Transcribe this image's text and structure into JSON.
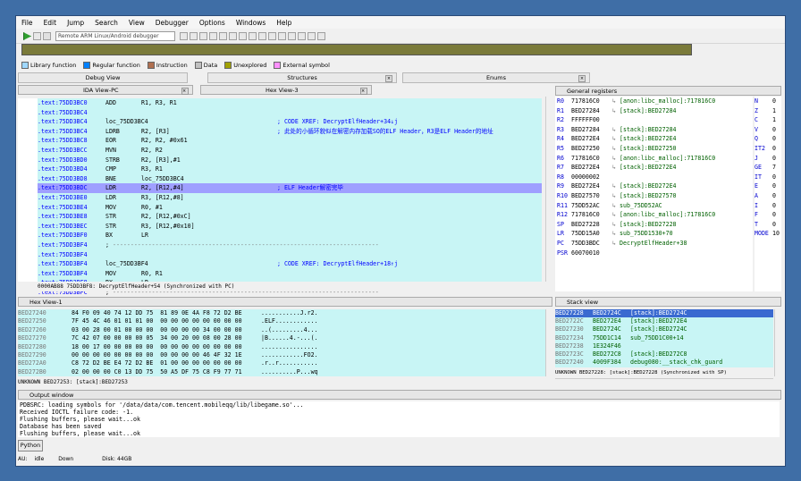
{
  "menu": [
    "File",
    "Edit",
    "Jump",
    "Search",
    "View",
    "Debugger",
    "Options",
    "Windows",
    "Help"
  ],
  "toolbar": {
    "debugger_select": "Remote ARM Linux/Android debugger"
  },
  "legend": [
    {
      "label": "Library function",
      "color": "#a0d8ff"
    },
    {
      "label": "Regular function",
      "color": "#0080ff"
    },
    {
      "label": "Instruction",
      "color": "#b07050"
    },
    {
      "label": "Data",
      "color": "#c0c0c0"
    },
    {
      "label": "Unexplored",
      "color": "#a0a000"
    },
    {
      "label": "External symbol",
      "color": "#ff90ff"
    }
  ],
  "top_tabs": [
    "Debug View",
    "Structures",
    "Enums"
  ],
  "ida_view": {
    "title": "IDA View-PC",
    "hex_tab": "Hex View-3"
  },
  "code_lines": [
    {
      "addr": ".text:75DD3BC0",
      "mn": "ADD",
      "op": "R1, R3, R1",
      "cm": "",
      "hl": false
    },
    {
      "addr": ".text:75DD3BC4",
      "mn": "",
      "op": "",
      "cm": "",
      "hl": false
    },
    {
      "addr": ".text:75DD3BC4",
      "mn": "loc_75DD3BC4",
      "op": "",
      "cm": "; CODE XREF: DecryptElfHeader+34↓j",
      "hl": false
    },
    {
      "addr": ".text:75DD3BC4",
      "mn": "LDRB",
      "op": "R2, [R3]",
      "cm": "; 此处的小循环貌似在解密内存加载SO的ELF Header，R3是ELF Header的地址",
      "hl": false
    },
    {
      "addr": ".text:75DD3BC8",
      "mn": "EOR",
      "op": "R2, R2, #0x61",
      "cm": "",
      "hl": false
    },
    {
      "addr": ".text:75DD3BCC",
      "mn": "MVN",
      "op": "R2, R2",
      "cm": "",
      "hl": false
    },
    {
      "addr": ".text:75DD3BD0",
      "mn": "STRB",
      "op": "R2, [R3],#1",
      "cm": "",
      "hl": false
    },
    {
      "addr": ".text:75DD3BD4",
      "mn": "CMP",
      "op": "R3, R1",
      "cm": "",
      "hl": false
    },
    {
      "addr": ".text:75DD3BD8",
      "mn": "BNE",
      "op": "loc_75DD3BC4",
      "cm": "",
      "hl": false
    },
    {
      "addr": ".text:75DD3BDC",
      "mn": "LDR",
      "op": "R2, [R12,#4]",
      "cm": "; ELF Header解密完毕",
      "hl": true
    },
    {
      "addr": ".text:75DD3BE0",
      "mn": "LDR",
      "op": "R3, [R12,#8]",
      "cm": "",
      "hl": false
    },
    {
      "addr": ".text:75DD3BE4",
      "mn": "MOV",
      "op": "R0, #1",
      "cm": "",
      "hl": false
    },
    {
      "addr": ".text:75DD3BE8",
      "mn": "STR",
      "op": "R2, [R12,#0xC]",
      "cm": "",
      "hl": false
    },
    {
      "addr": ".text:75DD3BEC",
      "mn": "STR",
      "op": "R3, [R12,#0x10]",
      "cm": "",
      "hl": false
    },
    {
      "addr": ".text:75DD3BF0",
      "mn": "BX",
      "op": "LR",
      "cm": "",
      "hl": false
    },
    {
      "addr": ".text:75DD3BF4",
      "mn": ";",
      "op": "---------------------------------------------------------------------------",
      "cm": "",
      "hl": false
    },
    {
      "addr": ".text:75DD3BF4",
      "mn": "",
      "op": "",
      "cm": "",
      "hl": false
    },
    {
      "addr": ".text:75DD3BF4",
      "mn": "loc_75DD3BF4",
      "op": "",
      "cm": "; CODE XREF: DecryptElfHeader+18↑j",
      "hl": false
    },
    {
      "addr": ".text:75DD3BF4",
      "mn": "MOV",
      "op": "R0, R1",
      "cm": "",
      "hl": false
    },
    {
      "addr": ".text:75DD3BF8",
      "mn": "BX",
      "op": "LR",
      "cm": "",
      "hl": false
    },
    {
      "addr": ".text:75DD3BFC",
      "mn": ";",
      "op": "---------------------------------------------------------------------------",
      "cm": "",
      "hl": false
    }
  ],
  "ida_status": "0000AB88 75DD3BF8: DecryptElfHeader+54 (Synchronized with PC)",
  "registers_title": "General registers",
  "registers": [
    {
      "n": "R0",
      "v": "717816C0",
      "d": "[anon:libc_malloc]:717816C0"
    },
    {
      "n": "R1",
      "v": "BED27284",
      "d": "[stack]:BED27284"
    },
    {
      "n": "R2",
      "v": "FFFFFF00",
      "d": ""
    },
    {
      "n": "R3",
      "v": "BED27284",
      "d": "[stack]:BED27284"
    },
    {
      "n": "R4",
      "v": "BED272E4",
      "d": "[stack]:BED272E4"
    },
    {
      "n": "R5",
      "v": "BED27250",
      "d": "[stack]:BED27250"
    },
    {
      "n": "R6",
      "v": "717816C0",
      "d": "[anon:libc_malloc]:717816C0"
    },
    {
      "n": "R7",
      "v": "BED272E4",
      "d": "[stack]:BED272E4"
    },
    {
      "n": "R8",
      "v": "00000002",
      "d": ""
    },
    {
      "n": "R9",
      "v": "BED272E4",
      "d": "[stack]:BED272E4"
    },
    {
      "n": "R10",
      "v": "BED27570",
      "d": "[stack]:BED27570"
    },
    {
      "n": "R11",
      "v": "75DD52AC",
      "d": "sub_75DD52AC"
    },
    {
      "n": "R12",
      "v": "717816C0",
      "d": "[anon:libc_malloc]:717816C0"
    },
    {
      "n": "SP",
      "v": "BED27228",
      "d": "[stack]:BED27228"
    },
    {
      "n": "LR",
      "v": "75DD15A0",
      "d": "sub_75DD1530+70"
    },
    {
      "n": "PC",
      "v": "75DD3BDC",
      "d": "DecryptElfHeader+38"
    },
    {
      "n": "PSR",
      "v": "60070010",
      "d": ""
    }
  ],
  "flags": [
    {
      "n": "N",
      "v": "0"
    },
    {
      "n": "Z",
      "v": "1"
    },
    {
      "n": "C",
      "v": "1"
    },
    {
      "n": "V",
      "v": "0"
    },
    {
      "n": "Q",
      "v": "0"
    },
    {
      "n": "IT2",
      "v": "0"
    },
    {
      "n": "J",
      "v": "0"
    },
    {
      "n": "GE",
      "v": "7"
    },
    {
      "n": "IT",
      "v": "0"
    },
    {
      "n": "E",
      "v": "0"
    },
    {
      "n": "A",
      "v": "0"
    },
    {
      "n": "I",
      "v": "0"
    },
    {
      "n": "F",
      "v": "0"
    },
    {
      "n": "T",
      "v": "0"
    },
    {
      "n": "MODE",
      "v": "10"
    }
  ],
  "hex_title": "Hex View-1",
  "hex_rows": [
    {
      "a": "BED27240",
      "h": "84 F0 09 40 74 12 DD 75  81 89 0E 4A F8 72 D2 BE",
      "t": "...........J.r2."
    },
    {
      "a": "BED27250",
      "h": "7F 45 4C 46 01 01 01 00  00 00 00 00 00 00 00 00",
      "t": ".ELF............"
    },
    {
      "a": "BED27260",
      "h": "03 00 28 00 01 00 00 00  00 00 00 00 34 00 00 00",
      "t": "..(.........4..."
    },
    {
      "a": "BED27270",
      "h": "7C 42 07 00 00 00 00 05  34 00 20 00 08 00 28 00",
      "t": "|B......4.-...(."
    },
    {
      "a": "BED27280",
      "h": "18 00 17 00 00 00 00 00  00 00 00 00 00 00 00 00",
      "t": "................"
    },
    {
      "a": "BED27290",
      "h": "00 00 00 00 00 00 00 00  00 00 00 00 46 4F 32 1E",
      "t": "............FO2."
    },
    {
      "a": "BED272A0",
      "h": "C8 72 D2 BE E4 72 D2 BE  01 00 00 00 00 00 00 00",
      "t": ".r..r..........."
    },
    {
      "a": "BED272B0",
      "h": "02 00 00 00 C0 13 DD 75  50 A5 DF 75 C8 F9 77 71",
      "t": "..........P...wq"
    }
  ],
  "hex_status": "UNKNOWN BED27253: [stack]:BED27253",
  "stack_title": "Stack view",
  "stack_rows": [
    {
      "a": "BED27228",
      "v": "BED2724C",
      "d": "[stack]:BED2724C",
      "hl": true
    },
    {
      "a": "BED2722C",
      "v": "BED272E4",
      "d": "[stack]:BED272E4",
      "hl": false
    },
    {
      "a": "BED27230",
      "v": "BED2724C",
      "d": "[stack]:BED2724C",
      "hl": false
    },
    {
      "a": "BED27234",
      "v": "75DD1C14",
      "d": "sub_75DD1C00+14",
      "hl": false
    },
    {
      "a": "BED27238",
      "v": "1E324F46",
      "d": "",
      "hl": false
    },
    {
      "a": "BED2723C",
      "v": "BED272C8",
      "d": "[stack]:BED272C8",
      "hl": false
    },
    {
      "a": "BED27240",
      "v": "4009F384",
      "d": "debug080:__stack_chk_guard",
      "hl": false
    }
  ],
  "stack_status": "UNKNOWN BED27228: [stack]:BED27228 (Synchronized with SP)",
  "output_title": "Output window",
  "output_lines": [
    "PDBSRC: loading symbols for '/data/data/com.tencent.mobileqq/lib/libegame.so'...",
    "Received IOCTL failure code: -1.",
    "Flushing buffers, please wait...ok",
    "Database has been saved",
    "Flushing buffers, please wait...ok"
  ],
  "python_button": "Python",
  "statusbar": {
    "au": "AU:",
    "state": "idle",
    "dir": "Down",
    "disk": "Disk: 44GB"
  }
}
